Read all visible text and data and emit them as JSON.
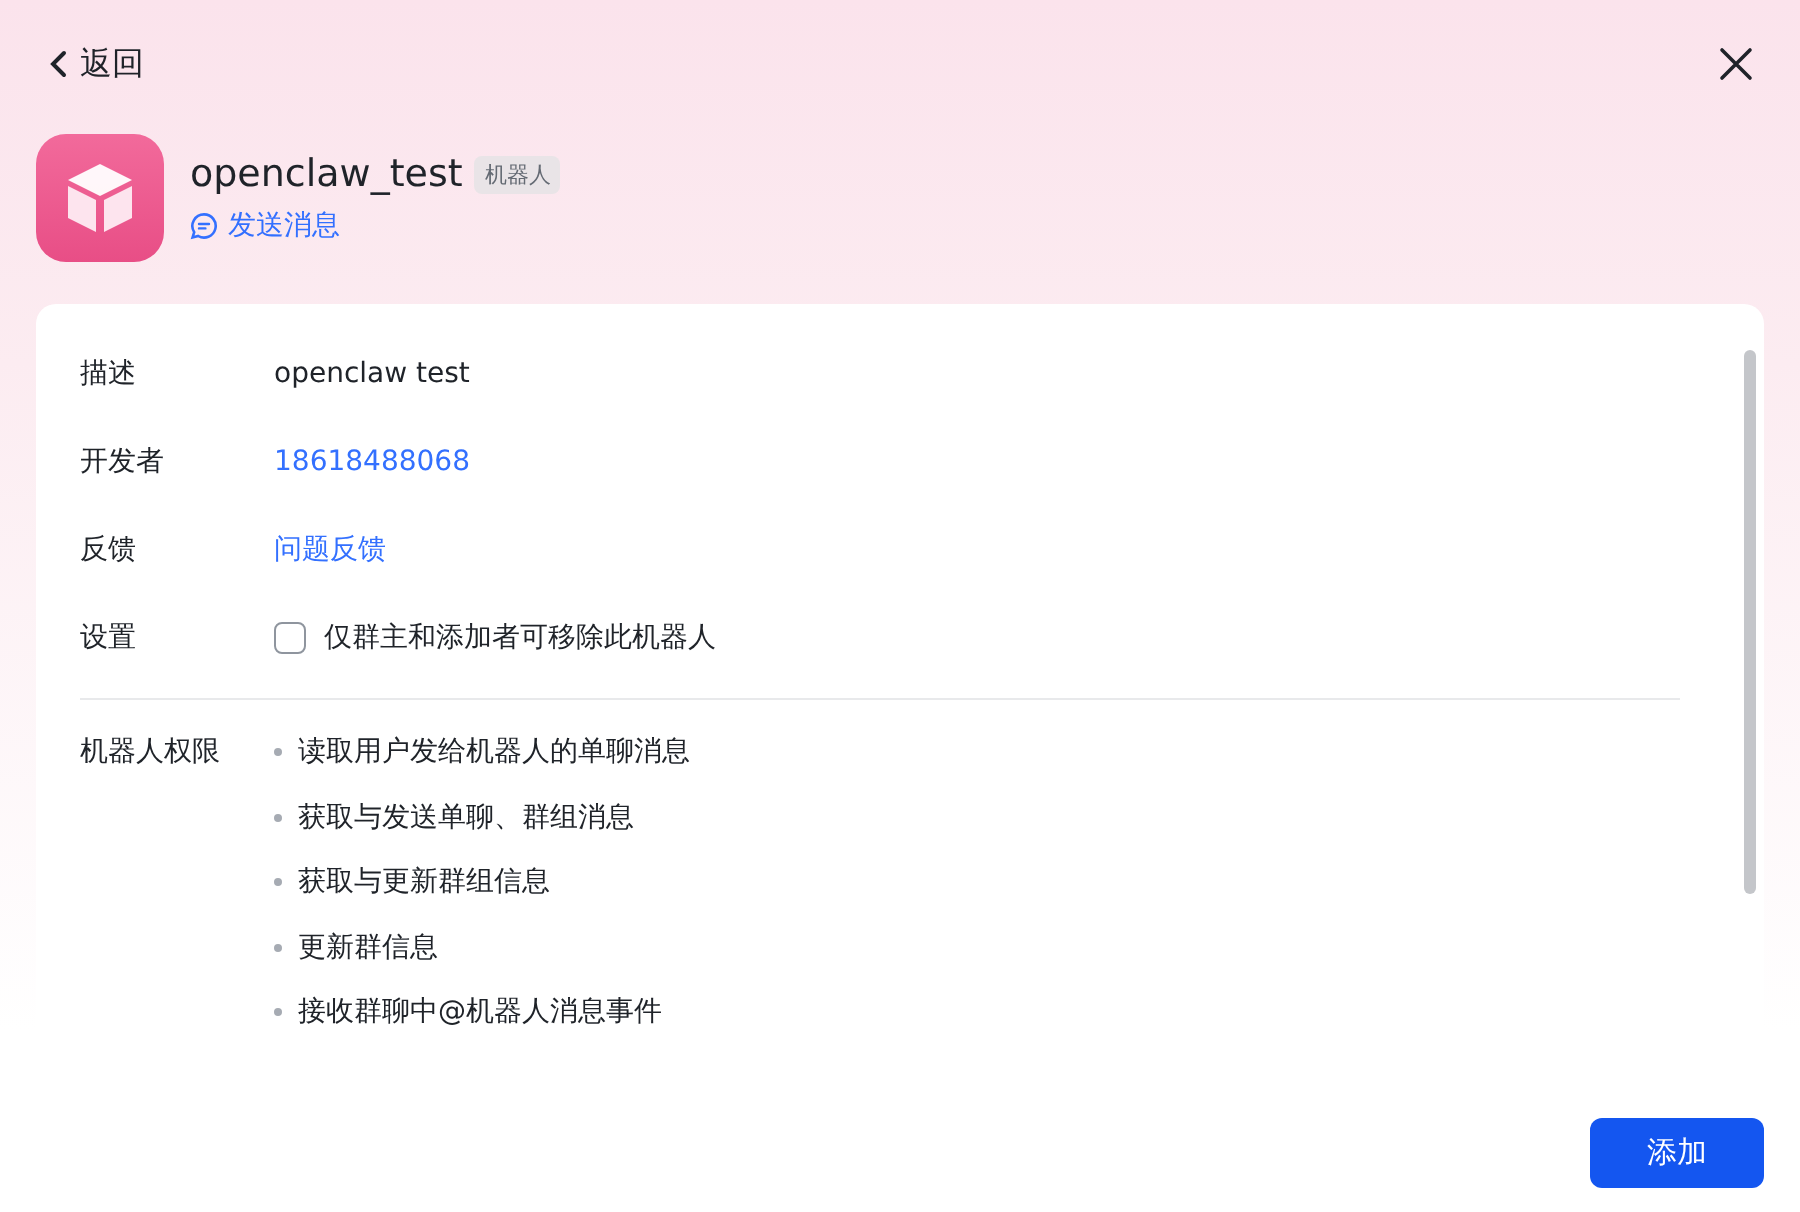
{
  "header": {
    "back_label": "返回"
  },
  "bot": {
    "name": "openclaw_test",
    "tag": "机器人",
    "send_message": "发送消息"
  },
  "details": [
    {
      "kind": "text",
      "label": "描述",
      "value": "openclaw test"
    },
    {
      "kind": "link",
      "label": "开发者",
      "value": "18618488068"
    },
    {
      "kind": "link",
      "label": "反馈",
      "value": "问题反馈"
    },
    {
      "kind": "checkbox",
      "label": "设置",
      "value": "仅群主和添加者可移除此机器人",
      "checked": false
    }
  ],
  "permissions": {
    "label": "机器人权限",
    "items": [
      "读取用户发给机器人的单聊消息",
      "获取与发送单聊、群组消息",
      "获取与更新群组信息",
      "更新群信息",
      "接收群聊中@机器人消息事件"
    ]
  },
  "footer": {
    "button": "添加"
  }
}
